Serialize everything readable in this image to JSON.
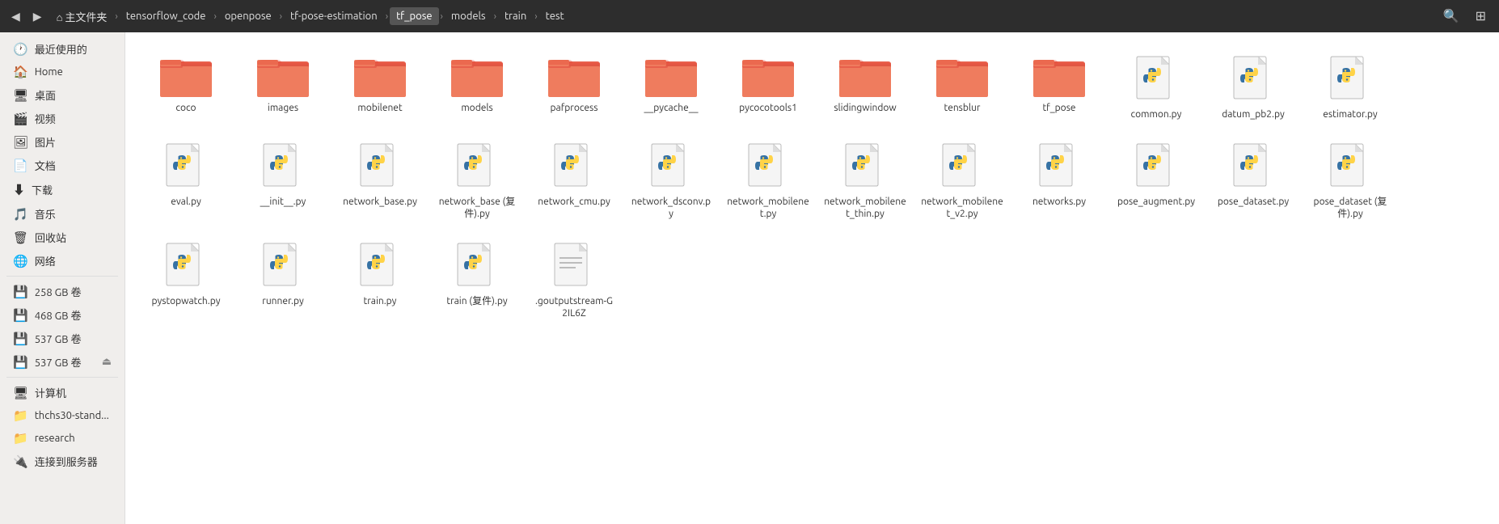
{
  "topbar": {
    "back_label": "◀",
    "forward_label": "▶",
    "breadcrumbs": [
      {
        "label": "⌂ 主文件夹",
        "active": false
      },
      {
        "label": "tensorflow_code",
        "active": false
      },
      {
        "label": "openpose",
        "active": false
      },
      {
        "label": "tf-pose-estimation",
        "active": false
      },
      {
        "label": "tf_pose",
        "active": true
      },
      {
        "label": "models",
        "active": false
      },
      {
        "label": "train",
        "active": false
      },
      {
        "label": "test",
        "active": false
      }
    ],
    "search_label": "🔍",
    "view_label": "⊞"
  },
  "sidebar": {
    "items": [
      {
        "icon": "🕐",
        "label": "最近使用的",
        "active": false,
        "eject": false
      },
      {
        "icon": "🏠",
        "label": "Home",
        "active": false,
        "eject": false
      },
      {
        "icon": "🖥",
        "label": "桌面",
        "active": false,
        "eject": false
      },
      {
        "icon": "🎬",
        "label": "视频",
        "active": false,
        "eject": false
      },
      {
        "icon": "🖼",
        "label": "图片",
        "active": false,
        "eject": false
      },
      {
        "icon": "📄",
        "label": "文档",
        "active": false,
        "eject": false
      },
      {
        "icon": "⬇",
        "label": "下载",
        "active": false,
        "eject": false
      },
      {
        "icon": "🎵",
        "label": "音乐",
        "active": false,
        "eject": false
      },
      {
        "icon": "🗑",
        "label": "回收站",
        "active": false,
        "eject": false
      },
      {
        "icon": "🌐",
        "label": "网络",
        "active": false,
        "eject": false
      }
    ],
    "drives": [
      {
        "icon": "💿",
        "label": "258 GB 卷",
        "eject": false
      },
      {
        "icon": "💿",
        "label": "468 GB 卷",
        "eject": false
      },
      {
        "icon": "💿",
        "label": "537 GB 卷",
        "eject": false
      },
      {
        "icon": "💿",
        "label": "537 GB 卷",
        "eject": true
      }
    ],
    "bookmarks": [
      {
        "icon": "🖥",
        "label": "计算机",
        "eject": false
      },
      {
        "icon": "📁",
        "label": "thchs30-stand...",
        "eject": false
      },
      {
        "icon": "📁",
        "label": "research",
        "eject": false
      },
      {
        "icon": "🔌",
        "label": "连接到服务器",
        "eject": false
      }
    ]
  },
  "files": [
    {
      "type": "folder",
      "name": "coco"
    },
    {
      "type": "folder",
      "name": "images"
    },
    {
      "type": "folder",
      "name": "mobilenet"
    },
    {
      "type": "folder",
      "name": "models"
    },
    {
      "type": "folder",
      "name": "pafprocess"
    },
    {
      "type": "folder",
      "name": "__pycache__"
    },
    {
      "type": "folder",
      "name": "pycocotools1"
    },
    {
      "type": "folder",
      "name": "slidingwindow"
    },
    {
      "type": "folder",
      "name": "tensblur"
    },
    {
      "type": "folder",
      "name": "tf_pose"
    },
    {
      "type": "py",
      "name": "common.py"
    },
    {
      "type": "py",
      "name": "datum_pb2.py"
    },
    {
      "type": "py",
      "name": "estimator.py"
    },
    {
      "type": "py",
      "name": "eval.py"
    },
    {
      "type": "py",
      "name": "__init__.py"
    },
    {
      "type": "py",
      "name": "network_base.py"
    },
    {
      "type": "py",
      "name": "network_base (复件).py"
    },
    {
      "type": "py",
      "name": "network_cmu.py"
    },
    {
      "type": "py",
      "name": "network_dsconv.py"
    },
    {
      "type": "py",
      "name": "network_mobilenet.py"
    },
    {
      "type": "py",
      "name": "network_mobilenet_thin.py"
    },
    {
      "type": "py",
      "name": "network_mobilenet_v2.py"
    },
    {
      "type": "py",
      "name": "networks.py"
    },
    {
      "type": "py",
      "name": "pose_augment.py"
    },
    {
      "type": "py",
      "name": "pose_dataset.py"
    },
    {
      "type": "py",
      "name": "pose_dataset (复件).py"
    },
    {
      "type": "py",
      "name": "pystopwatch.py"
    },
    {
      "type": "py",
      "name": "runner.py"
    },
    {
      "type": "py",
      "name": "train.py"
    },
    {
      "type": "py",
      "name": "train (复件).py"
    },
    {
      "type": "text",
      "name": ".goutputstream-G2IL6Z"
    }
  ]
}
